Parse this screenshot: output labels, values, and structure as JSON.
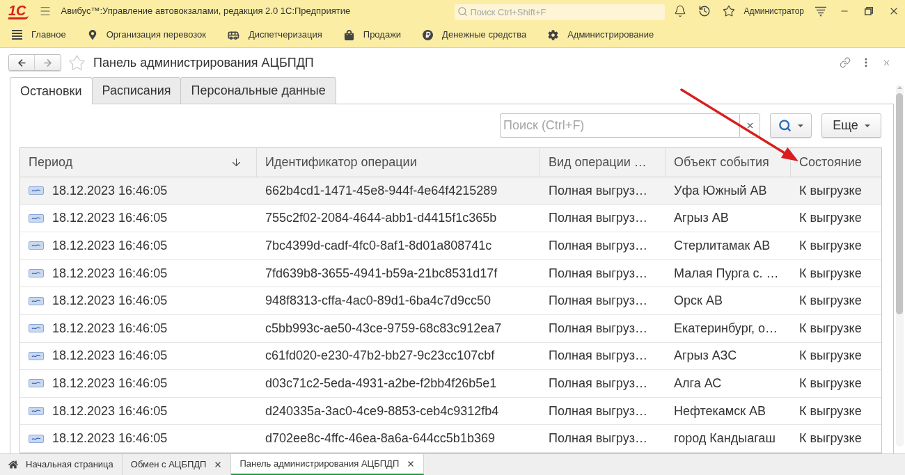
{
  "app_window": {
    "logo": "1С",
    "title": "Авибус™:Управление автовокзалами, редакция 2.0 1С:Предприятие",
    "search": {
      "placeholder": "Поиск Ctrl+Shift+F"
    },
    "user": "Администратор"
  },
  "sections": [
    {
      "kind": "list",
      "label": "Главное"
    },
    {
      "kind": "pin",
      "label": "Организация перевозок"
    },
    {
      "kind": "bus",
      "label": "Диспетчеризация"
    },
    {
      "kind": "bag",
      "label": "Продажи"
    },
    {
      "kind": "ruble",
      "label": "Денежные средства"
    },
    {
      "kind": "gear",
      "label": "Администрирование"
    }
  ],
  "form": {
    "title": "Панель администрирования АЦБПДП",
    "favorite": false,
    "tabs": [
      {
        "label": "Остановки",
        "selected": true
      },
      {
        "label": "Расписания",
        "selected": false
      },
      {
        "label": "Персональные данные",
        "selected": false
      }
    ],
    "search": {
      "placeholder": "Поиск (Ctrl+F)"
    },
    "more_button": "Еще",
    "table": {
      "columns": [
        {
          "label": "Период",
          "sorted": true
        },
        {
          "label": "Идентификатор операции",
          "sorted": false
        },
        {
          "label": "Вид операции …",
          "sorted": false
        },
        {
          "label": "Объект события",
          "sorted": false
        },
        {
          "label": "Состояние",
          "sorted": false
        }
      ],
      "rows": [
        {
          "selected": true,
          "period": "18.12.2023 16:46:05",
          "operation_id": "662b4cd1-1471-45e8-944f-4e64f4215289",
          "operation_type": "Полная выгруз…",
          "event_object": "Уфа Южный АВ",
          "state": "К выгрузке"
        },
        {
          "selected": false,
          "period": "18.12.2023 16:46:05",
          "operation_id": "755c2f02-2084-4644-abb1-d4415f1c365b",
          "operation_type": "Полная выгруз…",
          "event_object": "Агрыз АВ",
          "state": "К выгрузке"
        },
        {
          "selected": false,
          "period": "18.12.2023 16:46:05",
          "operation_id": "7bc4399d-cadf-4fc0-8af1-8d01a808741c",
          "operation_type": "Полная выгруз…",
          "event_object": "Стерлитамак АВ",
          "state": "К выгрузке"
        },
        {
          "selected": false,
          "period": "18.12.2023 16:46:05",
          "operation_id": "7fd639b8-3655-4941-b59a-21bc8531d17f",
          "operation_type": "Полная выгруз…",
          "event_object": "Малая Пурга с. …",
          "state": "К выгрузке"
        },
        {
          "selected": false,
          "period": "18.12.2023 16:46:05",
          "operation_id": "948f8313-cffa-4ac0-89d1-6ba4c7d9cc50",
          "operation_type": "Полная выгруз…",
          "event_object": "Орск АВ",
          "state": "К выгрузке"
        },
        {
          "selected": false,
          "period": "18.12.2023 16:46:05",
          "operation_id": "c5bb993c-ae50-43ce-9759-68c83c912ea7",
          "operation_type": "Полная выгруз…",
          "event_object": "Екатеринбург, о…",
          "state": "К выгрузке"
        },
        {
          "selected": false,
          "period": "18.12.2023 16:46:05",
          "operation_id": "c61fd020-e230-47b2-bb27-9c23cc107cbf",
          "operation_type": "Полная выгруз…",
          "event_object": "Агрыз АЗС",
          "state": "К выгрузке"
        },
        {
          "selected": false,
          "period": "18.12.2023 16:46:05",
          "operation_id": "d03c71c2-5eda-4931-a2be-f2bb4f26b5e1",
          "operation_type": "Полная выгруз…",
          "event_object": "Алга АС",
          "state": "К выгрузке"
        },
        {
          "selected": false,
          "period": "18.12.2023 16:46:05",
          "operation_id": "d240335a-3ac0-4ce9-8853-ceb4c9312fb4",
          "operation_type": "Полная выгруз…",
          "event_object": "Нефтекамск АВ",
          "state": "К выгрузке"
        },
        {
          "selected": false,
          "period": "18.12.2023 16:46:05",
          "operation_id": "d702ee8c-4ffc-46ea-8a6a-644cc5b1b369",
          "operation_type": "Полная выгруз…",
          "event_object": "город Кандыагаш",
          "state": "К выгрузке"
        }
      ]
    }
  },
  "open_windows": [
    {
      "kind": "home",
      "label": "Начальная страница",
      "selected": false
    },
    {
      "kind": "form",
      "label": "Обмен с АЦБПДП",
      "selected": false
    },
    {
      "kind": "form",
      "label": "Панель администрирования АЦБПДП",
      "selected": true
    }
  ]
}
